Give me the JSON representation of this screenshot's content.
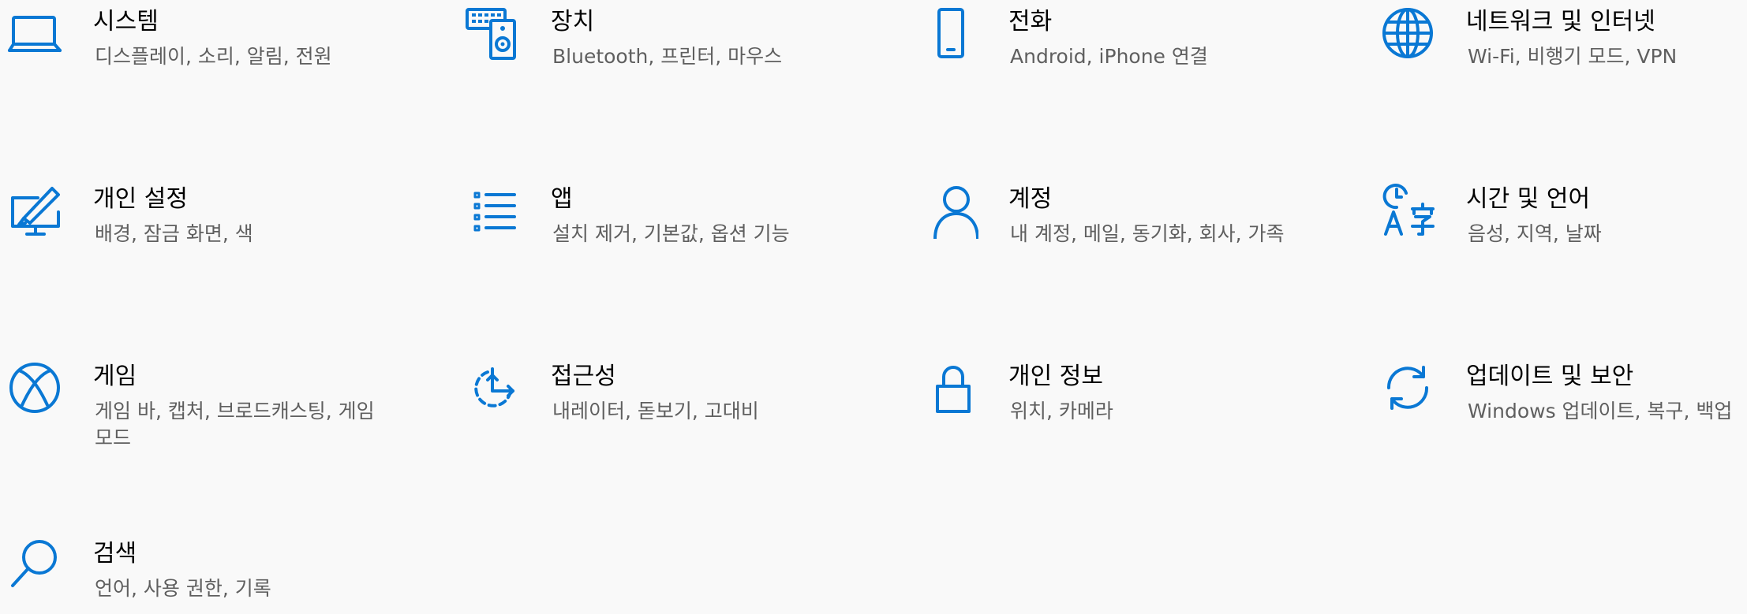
{
  "accent_color": "#0a78d4",
  "tiles": [
    {
      "title": "시스템",
      "desc": "디스플레이, 소리, 알림, 전원",
      "icon": "laptop-icon"
    },
    {
      "title": "장치",
      "desc": "Bluetooth, 프린터, 마우스",
      "icon": "devices-icon"
    },
    {
      "title": "전화",
      "desc": "Android, iPhone 연결",
      "icon": "phone-icon"
    },
    {
      "title": "네트워크 및 인터넷",
      "desc": "Wi-Fi, 비행기 모드, VPN",
      "icon": "globe-icon"
    },
    {
      "title": "개인 설정",
      "desc": "배경, 잠금 화면, 색",
      "icon": "personalization-icon"
    },
    {
      "title": "앱",
      "desc": "설치 제거, 기본값, 옵션 기능",
      "icon": "apps-list-icon"
    },
    {
      "title": "계정",
      "desc": "내 계정, 메일, 동기화, 회사, 가족",
      "icon": "person-icon"
    },
    {
      "title": "시간 및 언어",
      "desc": "음성, 지역, 날짜",
      "icon": "time-language-icon"
    },
    {
      "title": "게임",
      "desc": "게임 바, 캡처, 브로드캐스팅, 게임 모드",
      "icon": "xbox-icon"
    },
    {
      "title": "접근성",
      "desc": "내레이터, 돋보기, 고대비",
      "icon": "ease-of-access-icon"
    },
    {
      "title": "개인 정보",
      "desc": "위치, 카메라",
      "icon": "lock-icon"
    },
    {
      "title": "업데이트 및 보안",
      "desc": "Windows 업데이트, 복구, 백업",
      "icon": "sync-icon"
    },
    {
      "title": "검색",
      "desc": "언어, 사용 권한, 기록",
      "icon": "search-icon"
    }
  ]
}
